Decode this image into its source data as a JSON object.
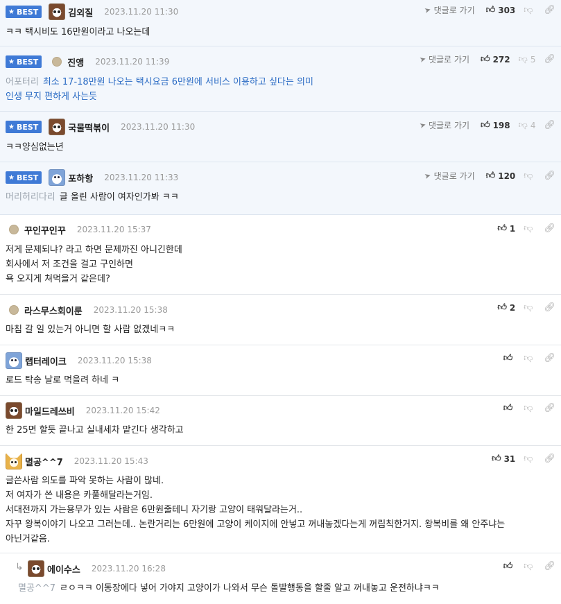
{
  "comments": [
    {
      "best": true,
      "badge": "BEST",
      "avatar": "dog",
      "nick": "김외질",
      "date": "2023.11.20 11:30",
      "reply_link": "댓글로 가기",
      "up": "303",
      "down": "",
      "prefix": "",
      "lines": [
        "ㅋㅋ 택시비도 16만원이라고 나오는데"
      ]
    },
    {
      "best": true,
      "badge": "BEST",
      "avatar": "dot",
      "nick": "진앵",
      "date": "2023.11.20 11:39",
      "reply_link": "댓글로 가기",
      "up": "272",
      "down": "5",
      "prefix": "어포터리",
      "lines": [
        "최소 17-18만원 나오는 택시요금 6만원에 서비스 이용하고 싶다는 의미",
        "인생 무지 편하게 사는듯"
      ]
    },
    {
      "best": true,
      "badge": "BEST",
      "avatar": "dog",
      "nick": "국물떡볶이",
      "date": "2023.11.20 11:30",
      "reply_link": "댓글로 가기",
      "up": "198",
      "down": "4",
      "prefix": "",
      "lines": [
        "ㅋㅋ양심없는년"
      ]
    },
    {
      "best": true,
      "badge": "BEST",
      "avatar": "blue",
      "nick": "포하항",
      "date": "2023.11.20 11:33",
      "reply_link": "댓글로 가기",
      "up": "120",
      "down": "",
      "prefix": "머리허리다리",
      "lines": [
        "글 올린 사람이 여자인가봐 ㅋㅋ"
      ]
    },
    {
      "best": false,
      "avatar": "dot",
      "nick": "꾸인꾸인꾸",
      "date": "2023.11.20 15:37",
      "up": "1",
      "lines": [
        "저게 문제되냐? 라고 하면 문제까진 아니긴한데",
        "회사에서 저 조건을 걸고 구인하면",
        "욕 오지게 쳐먹을거 같은데?"
      ]
    },
    {
      "best": false,
      "avatar": "dot",
      "nick": "라스무스회이룬",
      "date": "2023.11.20 15:38",
      "up": "2",
      "lines": [
        "마침 갈 일 있는거 아니면 할 사람 없겠네ㅋㅋ"
      ]
    },
    {
      "best": false,
      "avatar": "blue",
      "nick": "랩터레이크",
      "date": "2023.11.20 15:38",
      "up": "",
      "lines": [
        "로드 탁송 날로 먹을려 하네 ㅋ"
      ]
    },
    {
      "best": false,
      "avatar": "dog",
      "nick": "마일드레쓰비",
      "date": "2023.11.20 15:42",
      "up": "",
      "lines": [
        "한 25면 할듯 끝나고 실내세차 맡긴다 생각하고"
      ]
    },
    {
      "best": false,
      "avatar": "fox",
      "nick": "멸공^^7",
      "date": "2023.11.20 15:43",
      "up": "31",
      "lines": [
        "글쓴사람 의도를 파악 못하는 사람이 많네.",
        "저 여자가 쓴 내용은 카풀해달라는거임.",
        "서대전까지 가는용무가 있는 사람은 6만원줄테니 자기랑 고양이 태워달라는거..",
        "자꾸 왕복이야기 나오고 그러는데.. 논란거리는 6만원에 고양이 케이지에 안넣고 꺼내놓겠다는게 꺼림칙한거지. 왕복비를 왜 안주냐는",
        "아닌거같음."
      ]
    },
    {
      "best": false,
      "reply": true,
      "reply_mark": "↳",
      "avatar": "dog",
      "nick": "에이수스",
      "date": "2023.11.20 16:28",
      "up": "",
      "prefix": "멸공^^7",
      "lines": [
        "ㄹㅇㅋㅋ 이동장에다 넣어 가야지 고양이가 나와서 무슨 돌발행동을 할줄 알고 꺼내놓고 운전하냐ㅋㅋ"
      ]
    }
  ]
}
